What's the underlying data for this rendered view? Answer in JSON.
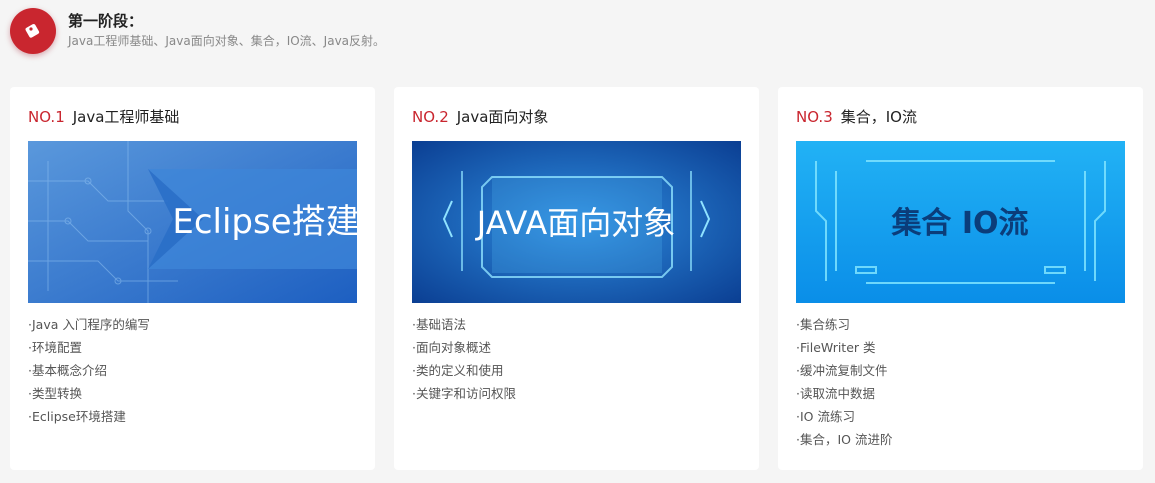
{
  "stage": {
    "title": "第一阶段：",
    "description": "Java工程师基础、Java面向对象、集合，IO流、Java反射。"
  },
  "cards": [
    {
      "number": "NO.1",
      "title": "Java工程师基础",
      "banner_text": "Eclipse搭建",
      "banner_icon": "circuit-pattern-icon",
      "topics": [
        "·Java 入门程序的编写",
        "·环境配置",
        "·基本概念介绍",
        "·类型转换",
        "·Eclipse环境搭建"
      ]
    },
    {
      "number": "NO.2",
      "title": "Java面向对象",
      "banner_text": "JAVA面向对象",
      "banner_icon": "tech-frame-icon",
      "topics": [
        "·基础语法",
        "·面向对象概述",
        "·类的定义和使用",
        "·关键字和访问权限"
      ]
    },
    {
      "number": "NO.3",
      "title": "集合，IO流",
      "banner_text": "集合 IO流",
      "banner_icon": "tech-frame-icon",
      "topics": [
        "·集合练习",
        "·FileWriter 类",
        "·缓冲流复制文件",
        "·读取流中数据",
        "·IO 流练习",
        "·集合，IO 流进阶"
      ]
    }
  ],
  "colors": {
    "accent": "#c9262f",
    "background": "#f5f5f5",
    "card": "#ffffff"
  }
}
